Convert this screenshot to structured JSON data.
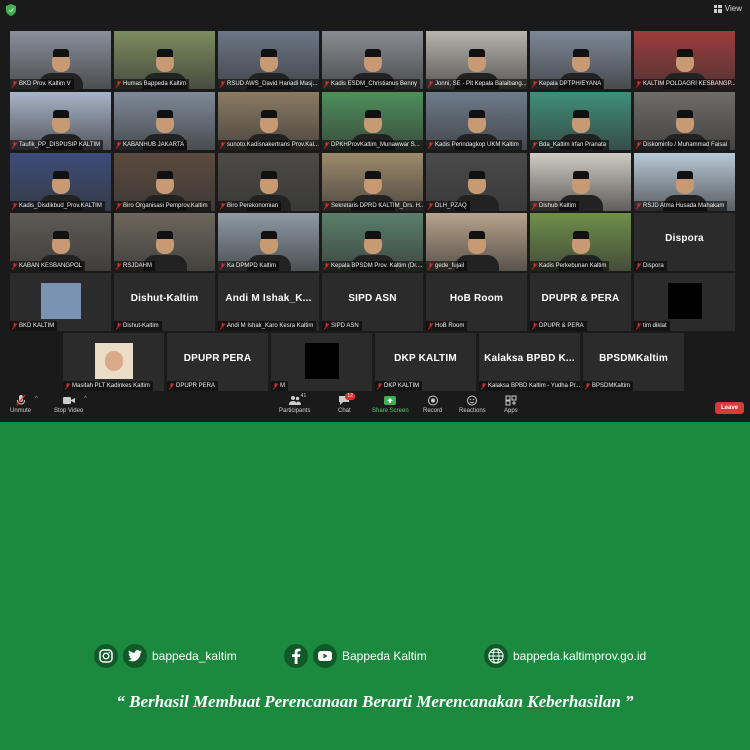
{
  "window": {
    "view_label": "View"
  },
  "participants": [
    {
      "label": "BKD Prov. Kaltim V",
      "bg": "#8a8f9a",
      "active": true
    },
    {
      "label": "Humas Bappeda Kaltim",
      "bg": "#7d8c5f"
    },
    {
      "label": "RSUD AWS_David Hariadi Masj...",
      "bg": "#6c7686"
    },
    {
      "label": "Kadis ESDM_Christianus Benny",
      "bg": "#8a8c93"
    },
    {
      "label": "Jonni, SE - Plt Kepala Balaibang...",
      "bg": "#b7b5ad"
    },
    {
      "label": "Kepala DPTPH/EYANA",
      "bg": "#7d8897"
    },
    {
      "label": "KALTIM POLDAGRI KESBANGP...",
      "bg": "#9e3b3b"
    },
    {
      "label": "Taufik_PP_DISPUSIP KALTIM",
      "bg": "#a8b4c8"
    },
    {
      "label": "KABANHUB JAKARTA",
      "bg": "#7e8a99"
    },
    {
      "label": "sunoto.Kadisnakertrans Prov.Kal...",
      "bg": "#8b7a63"
    },
    {
      "label": "DPKHProvKaltim_Munawwar S...",
      "bg": "#4e8f5b"
    },
    {
      "label": "Kadis Perindagkop UKM Kaltim",
      "bg": "#6d7b8a"
    },
    {
      "label": "Bda_Kaltim Irfan Pranata",
      "bg": "#3f8f7a"
    },
    {
      "label": "Diskominfo / Muhammad Faisal",
      "bg": "#6f6c69"
    },
    {
      "label": "Kadis_Disdikbud_Prov.KALTIM",
      "bg": "#3d4d7a"
    },
    {
      "label": "Biro Organisasi Pemprov.Kaltim",
      "bg": "#5b4a3e"
    },
    {
      "label": "Biro Perekonomian",
      "bg": "#4b4a46"
    },
    {
      "label": "Sekretaris DPRD KALTIM_Drs. H...",
      "bg": "#9c8a6b"
    },
    {
      "label": "DLH_PZAQ",
      "bg": "#4a4a4a"
    },
    {
      "label": "Dishub Kaltim",
      "bg": "#cfcbc4"
    },
    {
      "label": "RSJD Atma Husada Mahakam",
      "bg": "#b8c9d6"
    },
    {
      "label": "KABAN KESBANGPOL",
      "bg": "#5f5a55"
    },
    {
      "label": "RSJDAHM",
      "bg": "#6d665c"
    },
    {
      "label": "Ka DPMPD Kaltim",
      "bg": "#8e9aa4"
    },
    {
      "label": "Kepala BPSDM Prov. Kaltim (Dr....",
      "bg": "#5a7f6a"
    },
    {
      "label": "gede_fujail",
      "bg": "#b7a38c"
    },
    {
      "label": "Kadis Perkebunan Kaltim",
      "bg": "#6f8f4a"
    },
    {
      "label": "Dispora",
      "name_only": "Dispora"
    },
    {
      "label": "BKD KALTIM",
      "bg": "#7b93b3",
      "small_thumb": true
    },
    {
      "label": "Dishut-Kaltim",
      "name_only": "Dishut-Kaltim"
    },
    {
      "label": "Andi M Ishak_Karo Kesra Kaltim",
      "name_only": "Andi M Ishak_K..."
    },
    {
      "label": "SIPD ASN",
      "name_only": "SIPD ASN"
    },
    {
      "label": "HoB Room",
      "name_only": "HoB Room"
    },
    {
      "label": "DPUPR & PERA",
      "name_only": "DPUPR & PERA"
    },
    {
      "label": "tim diklat",
      "blank": true
    },
    {
      "label": "Masitah PLT Kadinkes Kaltim",
      "portrait": true
    },
    {
      "label": "DPUPR PERA",
      "name_only": "DPUPR PERA"
    },
    {
      "label": "M",
      "blank": true
    },
    {
      "label": "DKP KALTIM",
      "name_only": "DKP KALTIM"
    },
    {
      "label": "Kalaksa BPBD Kaltim - Yudha Pr...",
      "name_only": "Kalaksa BPBD K..."
    },
    {
      "label": "BPSDMKaltim",
      "name_only": "BPSDMKaltim"
    }
  ],
  "toolbar": {
    "unmute": "Unmute",
    "stop_video": "Stop Video",
    "participants": "Participants",
    "participants_count": "41",
    "chat": "Chat",
    "chat_badge": "12",
    "share_screen": "Share Screen",
    "record": "Record",
    "reactions": "Reactions",
    "apps": "Apps",
    "leave": "Leave"
  },
  "footer": {
    "handle": "bappeda_kaltim",
    "facebook": "Bappeda Kaltim",
    "website": "bappeda.kaltimprov.go.id",
    "tagline": "“ Berhasil  Membuat Perencanaan Berarti Merencanakan Keberhasilan ”"
  },
  "colors": {
    "background": "#1b8a3e",
    "zoom_bg": "#1a1a1a",
    "leave": "#d83a3a",
    "share": "#5ec96b"
  }
}
